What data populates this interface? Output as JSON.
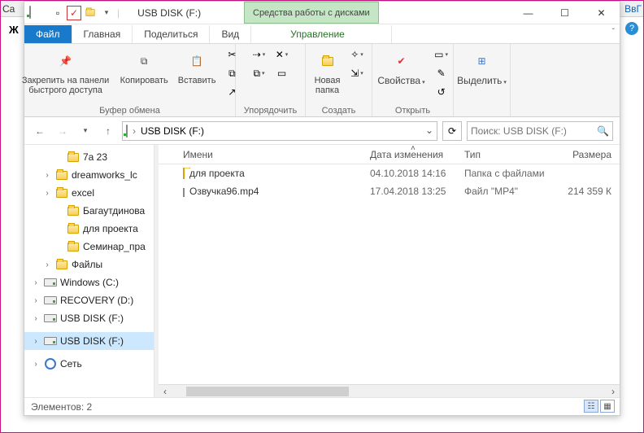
{
  "background": {
    "left_text": "Ca",
    "right_text": "ВвГ",
    "row2_text": "Ж"
  },
  "titlebar": {
    "drive_title": "USB DISK (F:)",
    "context_label": "Средства работы с дисками",
    "sys": {
      "min": "—",
      "max": "☐",
      "close": "✕"
    }
  },
  "tabs": {
    "file": "Файл",
    "home": "Главная",
    "share": "Поделиться",
    "view": "Вид",
    "manage": "Управление"
  },
  "ribbon": {
    "clipboard": {
      "pin": "Закрепить на панели быстрого доступа",
      "copy": "Копировать",
      "paste": "Вставить",
      "group": "Буфер обмена"
    },
    "organize": {
      "group": "Упорядочить"
    },
    "new": {
      "newfolder": "Новая папка",
      "group": "Создать"
    },
    "open": {
      "properties": "Свойства",
      "group": "Открыть"
    },
    "select": {
      "select": "Выделить",
      "group": ""
    }
  },
  "address": {
    "crumb": "USB DISK (F:)",
    "search_placeholder": "Поиск: USB DISK (F:)"
  },
  "columns": {
    "name": "Имени",
    "date": "Дата изменения",
    "type": "Тип",
    "size": "Размера"
  },
  "tree": [
    {
      "indent": 28,
      "exp": "",
      "icon": "folder",
      "label": "7а 23"
    },
    {
      "indent": 14,
      "exp": "›",
      "icon": "folder",
      "label": "dreamworks_lс"
    },
    {
      "indent": 14,
      "exp": "›",
      "icon": "folder",
      "label": "excel"
    },
    {
      "indent": 28,
      "exp": "",
      "icon": "folder",
      "label": "Багаутдинова"
    },
    {
      "indent": 28,
      "exp": "",
      "icon": "folder",
      "label": "для проекта"
    },
    {
      "indent": 28,
      "exp": "",
      "icon": "folder",
      "label": "Семинар_пра"
    },
    {
      "indent": 14,
      "exp": "›",
      "icon": "folder",
      "label": "Файлы"
    },
    {
      "indent": 0,
      "exp": "›",
      "icon": "drive",
      "label": "Windows (C:)"
    },
    {
      "indent": 0,
      "exp": "›",
      "icon": "drive",
      "label": "RECOVERY (D:)"
    },
    {
      "indent": 0,
      "exp": "›",
      "icon": "drive",
      "label": "USB DISK (F:)"
    },
    {
      "indent": 0,
      "exp": "›",
      "icon": "drive",
      "label": "USB DISK (F:)",
      "selected": true
    },
    {
      "indent": 0,
      "exp": "›",
      "icon": "net",
      "label": "Сеть"
    }
  ],
  "rows": [
    {
      "icon": "folder",
      "name": "для проекта",
      "date": "04.10.2018 14:16",
      "type": "Папка с файлами",
      "size": ""
    },
    {
      "icon": "file",
      "name": "Озвучка96.mp4",
      "date": "17.04.2018 13:25",
      "type": "Файл \"MP4\"",
      "size": "214 359 К"
    }
  ],
  "status": {
    "items": "Элементов: 2"
  }
}
